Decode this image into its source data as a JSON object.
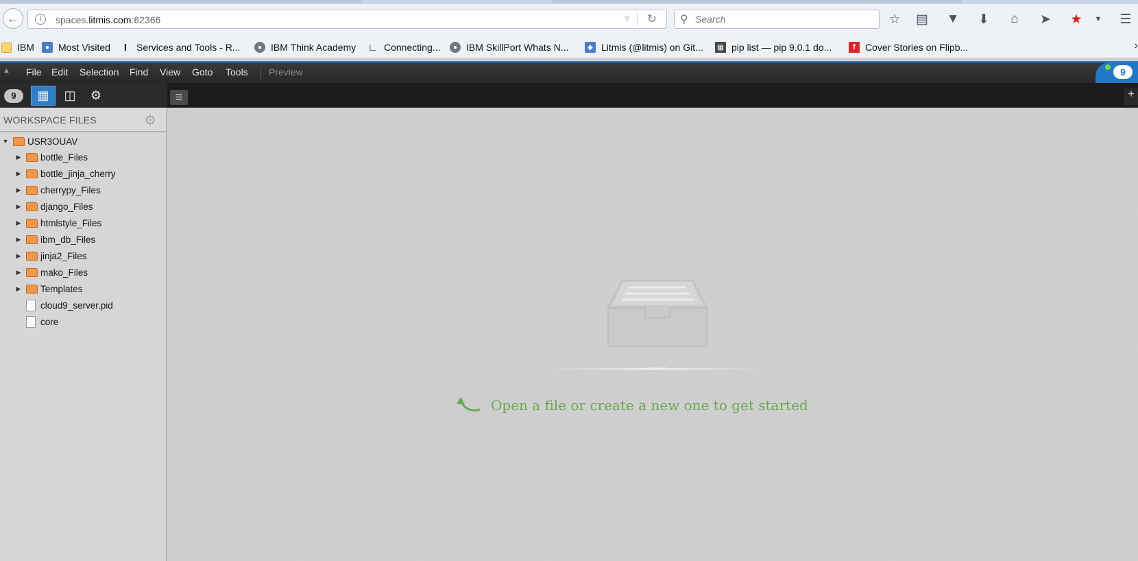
{
  "browser": {
    "url_host": "spaces.",
    "url_domain": "litmis.com",
    "url_port": ":62366",
    "search_placeholder": "Search",
    "bookmarks": [
      {
        "label": "IBM",
        "icon": "folder-icon"
      },
      {
        "label": "Most Visited",
        "icon": "most-visited-icon"
      },
      {
        "label": "Services and Tools - R...",
        "icon": "services-icon"
      },
      {
        "label": "IBM Think Academy",
        "icon": "globe-icon"
      },
      {
        "label": "Connecting...",
        "icon": "connecting-icon"
      },
      {
        "label": "IBM SkillPort Whats N...",
        "icon": "globe-icon"
      },
      {
        "label": "Litmis (@litmis) on Git...",
        "icon": "litmis-icon"
      },
      {
        "label": "pip list — pip 9.0.1 do...",
        "icon": "doc-icon"
      },
      {
        "label": "Cover Stories on Flipb...",
        "icon": "flipboard-icon"
      }
    ]
  },
  "ide": {
    "menus": [
      "File",
      "Edit",
      "Selection",
      "Find",
      "View",
      "Goto",
      "Tools"
    ],
    "preview_label": "Preview",
    "logo_text": "9",
    "workspace_title": "WORKSPACE FILES",
    "root_folder": "USR3OUAV",
    "folders": [
      "bottle_Files",
      "bottle_jinja_cherry",
      "cherrypy_Files",
      "django_Files",
      "htmlstyle_Files",
      "ibm_db_Files",
      "jinja2_Files",
      "mako_Files",
      "Templates"
    ],
    "files": [
      "cloud9_server.pid",
      "core"
    ],
    "empty_message": "Open a file or create a new one to get started"
  },
  "colors": {
    "accent_blue": "#2e7fc9",
    "hint_green": "#6aa84f",
    "folder_orange": "#f0974a"
  }
}
